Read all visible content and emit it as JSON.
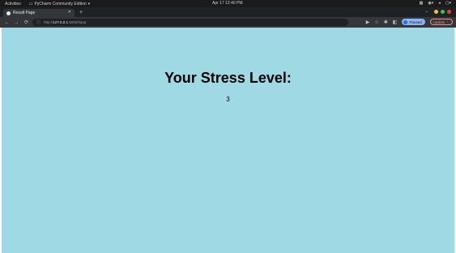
{
  "os_bar": {
    "activities": "Activities",
    "app_name": "PyCharm Community Edition",
    "clock": "Apr 17  12:40 PM"
  },
  "browser": {
    "tab_title": "Result Page",
    "url_prefix": "http://",
    "url_host": "127.0.0.1",
    "url_path": ":5000/input",
    "profile_label": "Paused",
    "update_label": "Update"
  },
  "page": {
    "heading": "Your Stress Level:",
    "stress_value": "3"
  },
  "colors": {
    "page_background": "#9fd9e4",
    "window_minimize": "#f4c430",
    "window_maximize": "#34c759",
    "window_close": "#e0443e"
  }
}
